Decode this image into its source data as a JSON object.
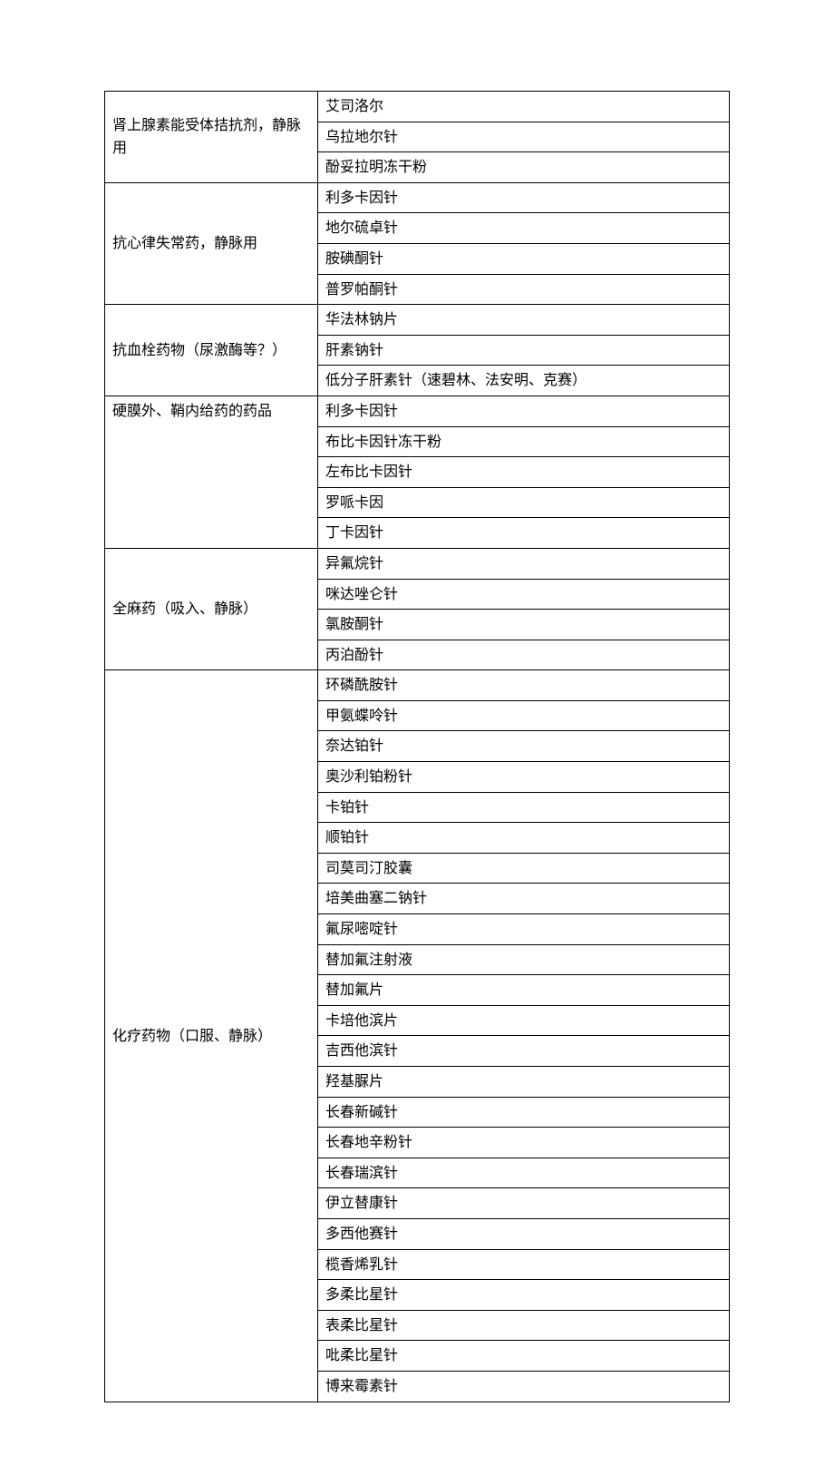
{
  "rows": [
    {
      "category": "肾上腺素能受体拮抗剂，静脉用",
      "items": [
        "艾司洛尔",
        "乌拉地尔针",
        "酚妥拉明冻干粉"
      ]
    },
    {
      "category": "抗心律失常药，静脉用",
      "items": [
        "利多卡因针",
        "地尔硫卓针",
        "胺碘酮针",
        "普罗帕酮针"
      ]
    },
    {
      "category": "抗血栓药物（尿激酶等？）",
      "items": [
        "华法林钠片",
        "肝素钠针",
        "低分子肝素针（速碧林、法安明、克赛）"
      ]
    },
    {
      "category": "硬膜外、鞘内给药的药品",
      "cat_valign": "top",
      "items": [
        "利多卡因针",
        "布比卡因针冻干粉",
        "左布比卡因针",
        "罗哌卡因",
        "丁卡因针"
      ]
    },
    {
      "category": "全麻药（吸入、静脉）",
      "items": [
        "异氟烷针",
        "咪达唑仑针",
        "氯胺酮针",
        "丙泊酚针"
      ]
    },
    {
      "category": "化疗药物（口服、静脉）",
      "items": [
        "环磷酰胺针",
        "甲氨蝶呤针",
        "奈达铂针",
        "奥沙利铂粉针",
        "卡铂针",
        "顺铂针",
        "司莫司汀胶囊",
        "培美曲塞二钠针",
        "氟尿嘧啶针",
        "替加氟注射液",
        "替加氟片",
        "卡培他滨片",
        "吉西他滨针",
        "羟基脲片",
        "长春新碱针",
        "长春地辛粉针",
        "长春瑞滨针",
        "伊立替康针",
        "多西他赛针",
        "榄香烯乳针",
        "多柔比星针",
        "表柔比星针",
        "吡柔比星针",
        "博来霉素针"
      ]
    }
  ]
}
